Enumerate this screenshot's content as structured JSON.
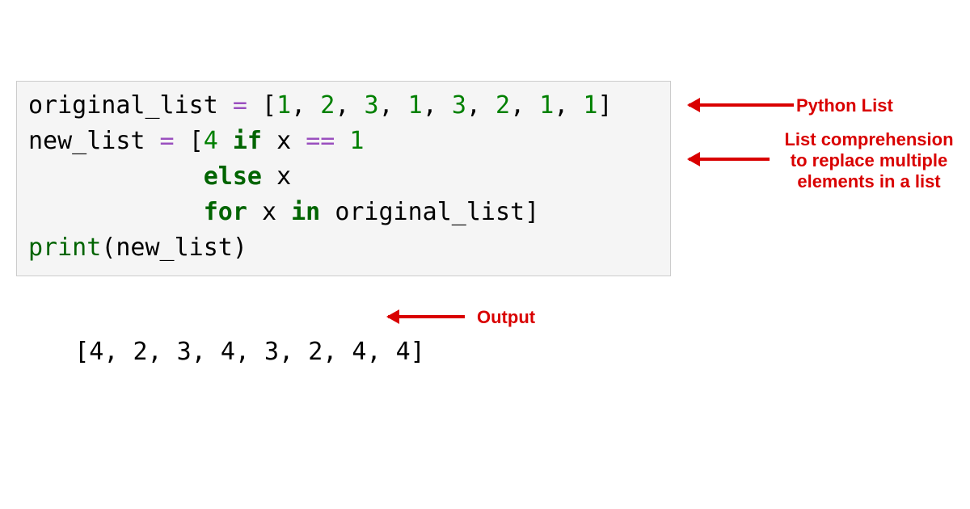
{
  "code": {
    "line1": {
      "var": "original_list",
      "assign": " = ",
      "lb": "[",
      "n1": "1",
      "c1": ", ",
      "n2": "2",
      "c2": ", ",
      "n3": "3",
      "c3": ", ",
      "n4": "1",
      "c4": ", ",
      "n5": "3",
      "c5": ", ",
      "n6": "2",
      "c6": ", ",
      "n7": "1",
      "c7": ", ",
      "n8": "1",
      "rb": "]"
    },
    "line2": {
      "var": "new_list",
      "assign": " = ",
      "lb": "[",
      "val": "4",
      "sp1": " ",
      "kw_if": "if",
      "sp2": " ",
      "x1": "x",
      "sp3": " ",
      "eq": "==",
      "sp4": " ",
      "one": "1"
    },
    "line3": {
      "indent": "            ",
      "kw_else": "else",
      "sp": " ",
      "x": "x"
    },
    "line4": {
      "indent": "            ",
      "kw_for": "for",
      "sp1": " ",
      "x": "x",
      "sp2": " ",
      "kw_in": "in",
      "sp3": " ",
      "src": "original_list",
      "rb": "]"
    },
    "line5": {
      "fn": "print",
      "lp": "(",
      "arg": "new_list",
      "rp": ")"
    }
  },
  "output": {
    "text": "[4, 2, 3, 4, 3, 2, 4, 4]"
  },
  "annotations": {
    "python_list": "Python List",
    "list_comp_l1": "List comprehension",
    "list_comp_l2": "to replace multiple",
    "list_comp_l3": "elements in a list",
    "output_label": "Output"
  },
  "colors": {
    "annotation": "#d90000",
    "cell_bg": "#f5f5f5",
    "cell_border": "#cccccc",
    "keyword": "#006400",
    "number": "#008000",
    "operator": "#9a4fbf"
  }
}
